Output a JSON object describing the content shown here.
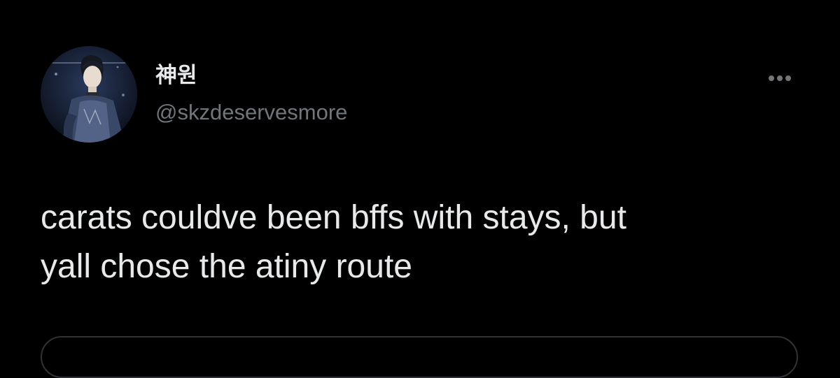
{
  "tweet": {
    "author": {
      "display_name": "神원",
      "handle": "@skzdeservesmore",
      "avatar": "profile-photo"
    },
    "text": "carats couldve been bffs with stays, but\nyall chose the atiny route",
    "more_icon": "more-horizontal-icon"
  },
  "colors": {
    "background": "#000000",
    "text_primary": "#e7e9ea",
    "text_secondary": "#71767b",
    "border": "#2f3336"
  }
}
